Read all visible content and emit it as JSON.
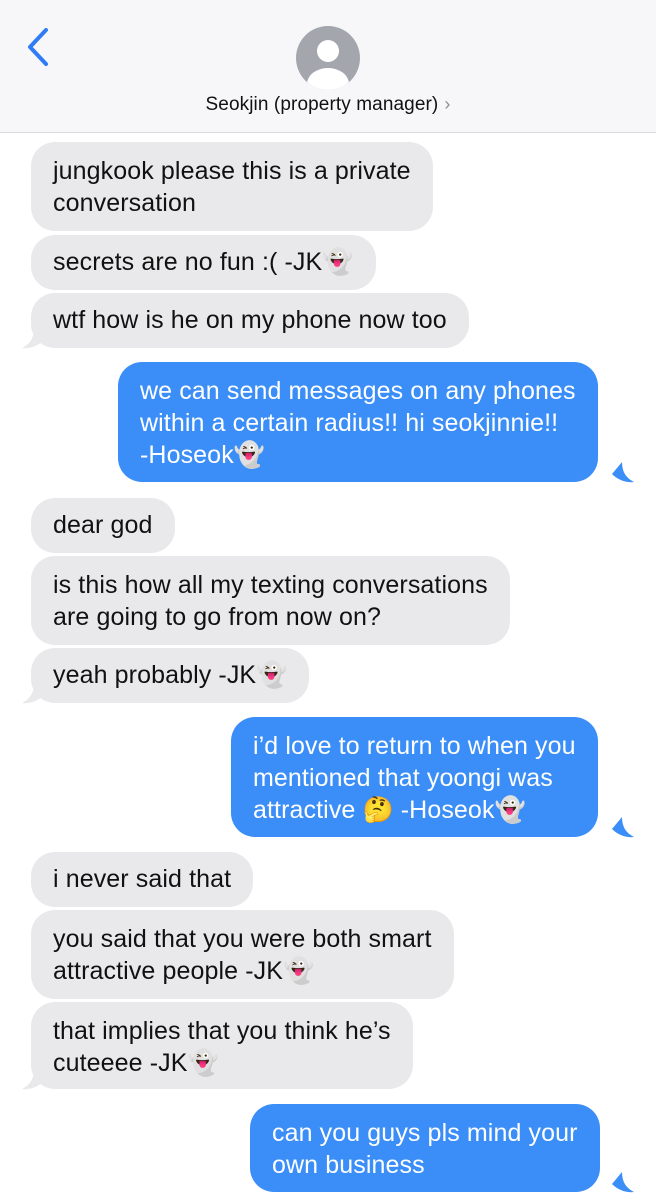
{
  "header": {
    "contact_name": "Seokjin (property manager)",
    "chevron": "›",
    "back_icon": "chevron-left-icon",
    "avatar_icon": "person-avatar-icon"
  },
  "colors": {
    "incoming_bubble": "#e9e9eb",
    "outgoing_bubble": "#3b8ef7",
    "accent": "#2f7cf6"
  },
  "messages": [
    {
      "direction": "incoming",
      "lines": [
        "jungkook please this is a private",
        "conversation"
      ]
    },
    {
      "direction": "incoming",
      "lines": [
        "secrets are no fun :( -JK👻"
      ]
    },
    {
      "direction": "incoming",
      "lines": [
        "wtf how is he on my phone now too"
      ]
    },
    {
      "direction": "outgoing",
      "lines": [
        "we can send messages on any phones",
        "within a certain radius!! hi seokjinnie!!",
        "-Hoseok👻"
      ]
    },
    {
      "direction": "incoming",
      "lines": [
        "dear god"
      ]
    },
    {
      "direction": "incoming",
      "lines": [
        "is this how all my texting conversations",
        "are going to go from now on?"
      ]
    },
    {
      "direction": "incoming",
      "lines": [
        "yeah probably -JK👻"
      ]
    },
    {
      "direction": "outgoing",
      "lines": [
        "i’d love to return to when you",
        "mentioned that yoongi was",
        "attractive 🤔 -Hoseok👻"
      ]
    },
    {
      "direction": "incoming",
      "lines": [
        "i never said that"
      ]
    },
    {
      "direction": "incoming",
      "lines": [
        "you said that you were both smart",
        "attractive people -JK👻"
      ]
    },
    {
      "direction": "incoming",
      "lines": [
        "that implies that you think he’s",
        "cuteeee -JK👻"
      ]
    },
    {
      "direction": "outgoing",
      "lines": [
        "can you guys pls mind your",
        "own business"
      ]
    }
  ]
}
